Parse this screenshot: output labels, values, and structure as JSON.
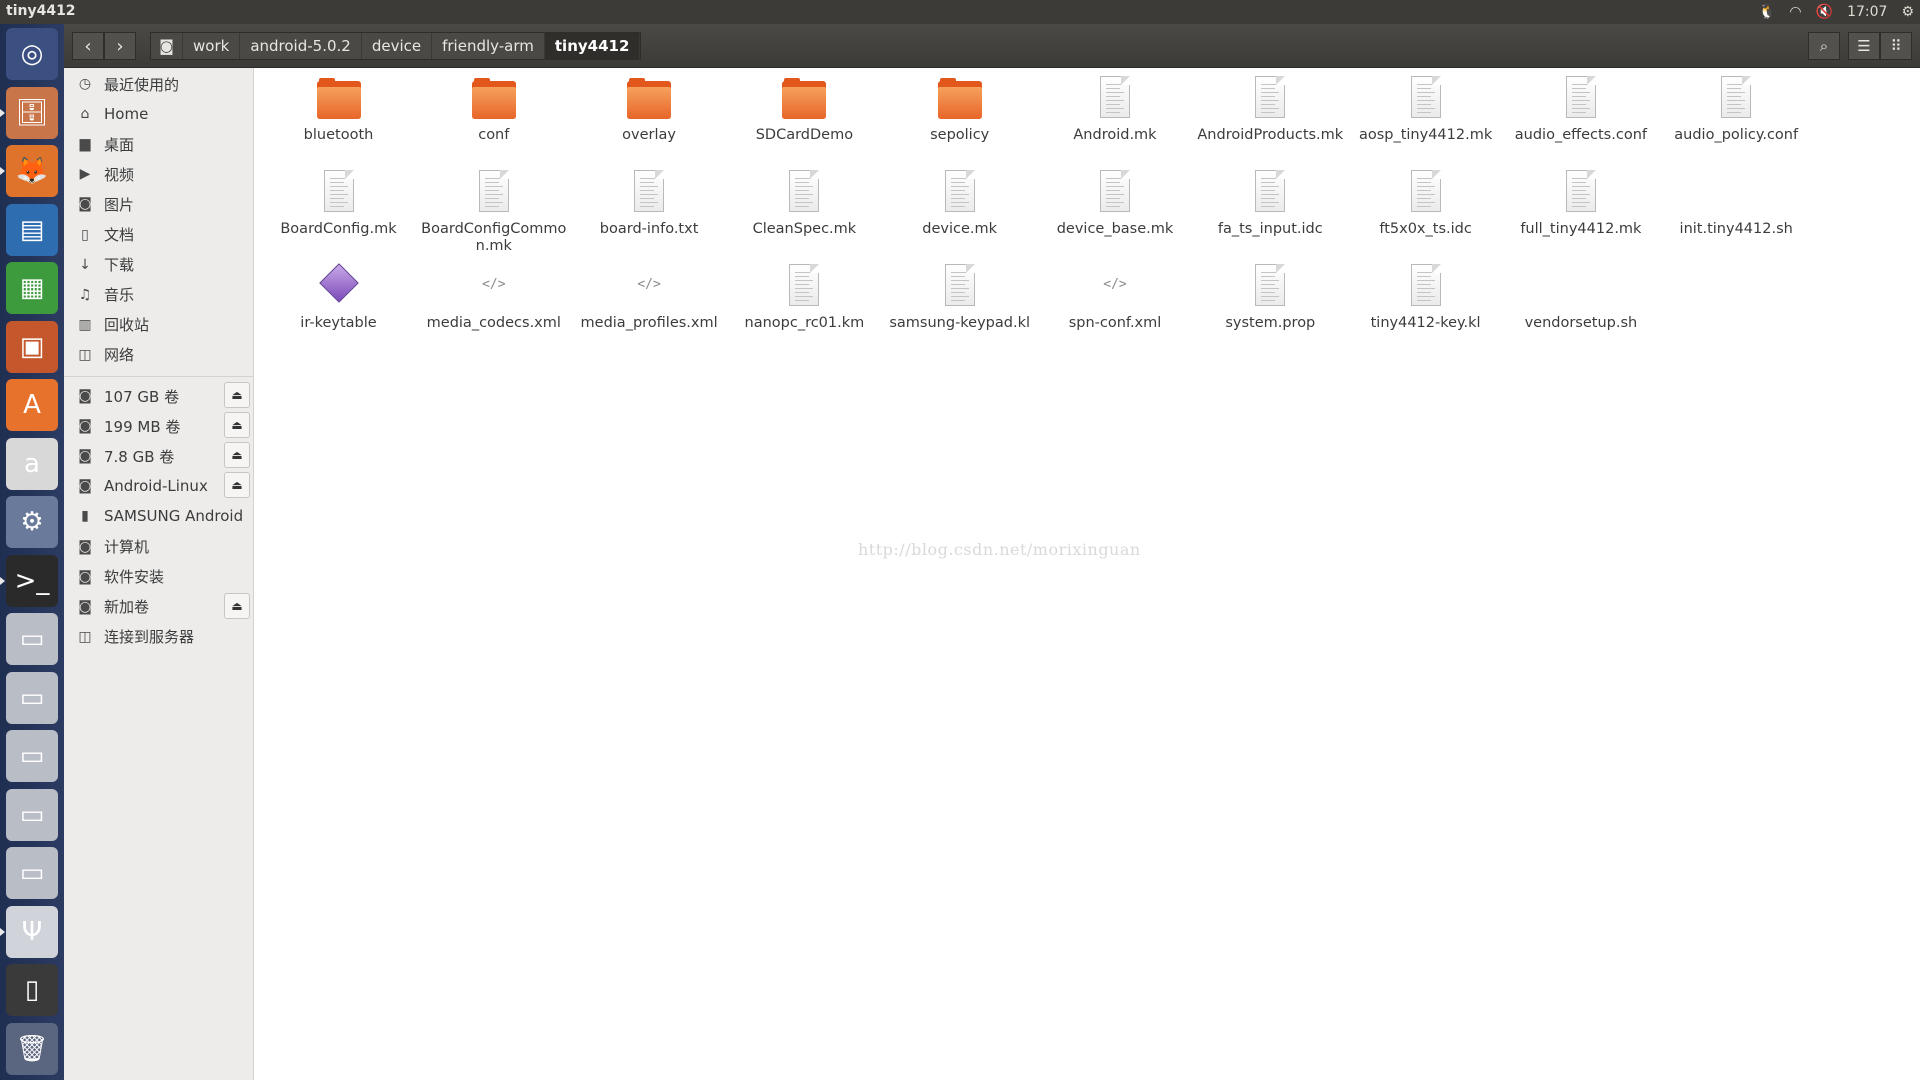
{
  "window": {
    "title": "tiny4412"
  },
  "tray": {
    "time": "17:07"
  },
  "launcher": {
    "items": [
      {
        "name": "dash-icon",
        "glyph": "◎",
        "bg": "#3b4f80"
      },
      {
        "name": "files-icon",
        "glyph": "🗄",
        "bg": "#c9754a"
      },
      {
        "name": "firefox-icon",
        "glyph": "🦊",
        "bg": "#e0732b"
      },
      {
        "name": "writer-icon",
        "glyph": "▤",
        "bg": "#2f6db1"
      },
      {
        "name": "calc-icon",
        "glyph": "▦",
        "bg": "#3d9b3d"
      },
      {
        "name": "impress-icon",
        "glyph": "▣",
        "bg": "#c4572b"
      },
      {
        "name": "software-center-icon",
        "glyph": "A",
        "bg": "#e7722c"
      },
      {
        "name": "amazon-icon",
        "glyph": "a",
        "bg": "#d8d8d8"
      },
      {
        "name": "settings-icon",
        "glyph": "⚙",
        "bg": "#6a7a9a"
      },
      {
        "name": "terminal-icon",
        "glyph": ">_",
        "bg": "#2a2a2a"
      },
      {
        "name": "drive-icon-1",
        "glyph": "▭",
        "bg": "#b9bdc5"
      },
      {
        "name": "drive-icon-2",
        "glyph": "▭",
        "bg": "#b9bdc5"
      },
      {
        "name": "drive-icon-3",
        "glyph": "▭",
        "bg": "#b9bdc5"
      },
      {
        "name": "drive-icon-4",
        "glyph": "▭",
        "bg": "#b9bdc5"
      },
      {
        "name": "drive-icon-5",
        "glyph": "▭",
        "bg": "#b9bdc5"
      },
      {
        "name": "usb-drive-icon",
        "glyph": "Ψ",
        "bg": "#d0d4da"
      },
      {
        "name": "phone-icon",
        "glyph": "▯",
        "bg": "#3a3a3a"
      },
      {
        "name": "trash-icon",
        "glyph": "🗑",
        "bg": "#5a6580"
      }
    ]
  },
  "breadcrumbs": [
    "work",
    "android-5.0.2",
    "device",
    "friendly-arm",
    "tiny4412"
  ],
  "sidebar": {
    "places": [
      {
        "icon": "◷",
        "icon_name": "recent-icon",
        "label": "最近使用的"
      },
      {
        "icon": "⌂",
        "icon_name": "home-icon",
        "label": "Home"
      },
      {
        "icon": "▆",
        "icon_name": "desktop-icon",
        "label": "桌面"
      },
      {
        "icon": "▶",
        "icon_name": "video-icon",
        "label": "视频"
      },
      {
        "icon": "◙",
        "icon_name": "camera-icon",
        "label": "图片"
      },
      {
        "icon": "▯",
        "icon_name": "document-icon",
        "label": "文档"
      },
      {
        "icon": "↓",
        "icon_name": "download-icon",
        "label": "下载"
      },
      {
        "icon": "♫",
        "icon_name": "music-icon",
        "label": "音乐"
      },
      {
        "icon": "▥",
        "icon_name": "trash-icon",
        "label": "回收站"
      },
      {
        "icon": "◫",
        "icon_name": "network-icon",
        "label": "网络"
      }
    ],
    "devices": [
      {
        "icon": "◙",
        "label": "107 GB 卷",
        "eject": true
      },
      {
        "icon": "◙",
        "label": "199 MB 卷",
        "eject": true
      },
      {
        "icon": "◙",
        "label": "7.8 GB 卷",
        "eject": true
      },
      {
        "icon": "◙",
        "label": "Android-Linux",
        "eject": true
      },
      {
        "icon": "▮",
        "label": "SAMSUNG Android",
        "eject": false
      },
      {
        "icon": "◙",
        "label": "计算机",
        "eject": false
      },
      {
        "icon": "◙",
        "label": "软件安装",
        "eject": false
      },
      {
        "icon": "◙",
        "label": "新加卷",
        "eject": true
      },
      {
        "icon": "◫",
        "label": "连接到服务器",
        "eject": false
      }
    ]
  },
  "files": [
    {
      "name": "bluetooth",
      "type": "folder"
    },
    {
      "name": "conf",
      "type": "folder"
    },
    {
      "name": "overlay",
      "type": "folder"
    },
    {
      "name": "SDCardDemo",
      "type": "folder"
    },
    {
      "name": "sepolicy",
      "type": "folder"
    },
    {
      "name": "Android.mk",
      "type": "doc"
    },
    {
      "name": "AndroidProducts.mk",
      "type": "doc"
    },
    {
      "name": "aosp_tiny4412.mk",
      "type": "doc"
    },
    {
      "name": "audio_effects.conf",
      "type": "doc"
    },
    {
      "name": "audio_policy.conf",
      "type": "doc"
    },
    {
      "name": "BoardConfig.mk",
      "type": "doc"
    },
    {
      "name": "BoardConfigCommon.mk",
      "type": "doc"
    },
    {
      "name": "board-info.txt",
      "type": "doc"
    },
    {
      "name": "CleanSpec.mk",
      "type": "doc"
    },
    {
      "name": "device.mk",
      "type": "doc"
    },
    {
      "name": "device_base.mk",
      "type": "doc"
    },
    {
      "name": "fa_ts_input.idc",
      "type": "doc"
    },
    {
      "name": "ft5x0x_ts.idc",
      "type": "doc"
    },
    {
      "name": "full_tiny4412.mk",
      "type": "doc"
    },
    {
      "name": "init.tiny4412.sh",
      "type": "script"
    },
    {
      "name": "ir-keytable",
      "type": "keytable"
    },
    {
      "name": "media_codecs.xml",
      "type": "code"
    },
    {
      "name": "media_profiles.xml",
      "type": "code"
    },
    {
      "name": "nanopc_rc01.km",
      "type": "doc"
    },
    {
      "name": "samsung-keypad.kl",
      "type": "doc"
    },
    {
      "name": "spn-conf.xml",
      "type": "code"
    },
    {
      "name": "system.prop",
      "type": "doc"
    },
    {
      "name": "tiny4412-key.kl",
      "type": "doc"
    },
    {
      "name": "vendorsetup.sh",
      "type": "script"
    }
  ],
  "watermark": "http://blog.csdn.net/morixinguan"
}
